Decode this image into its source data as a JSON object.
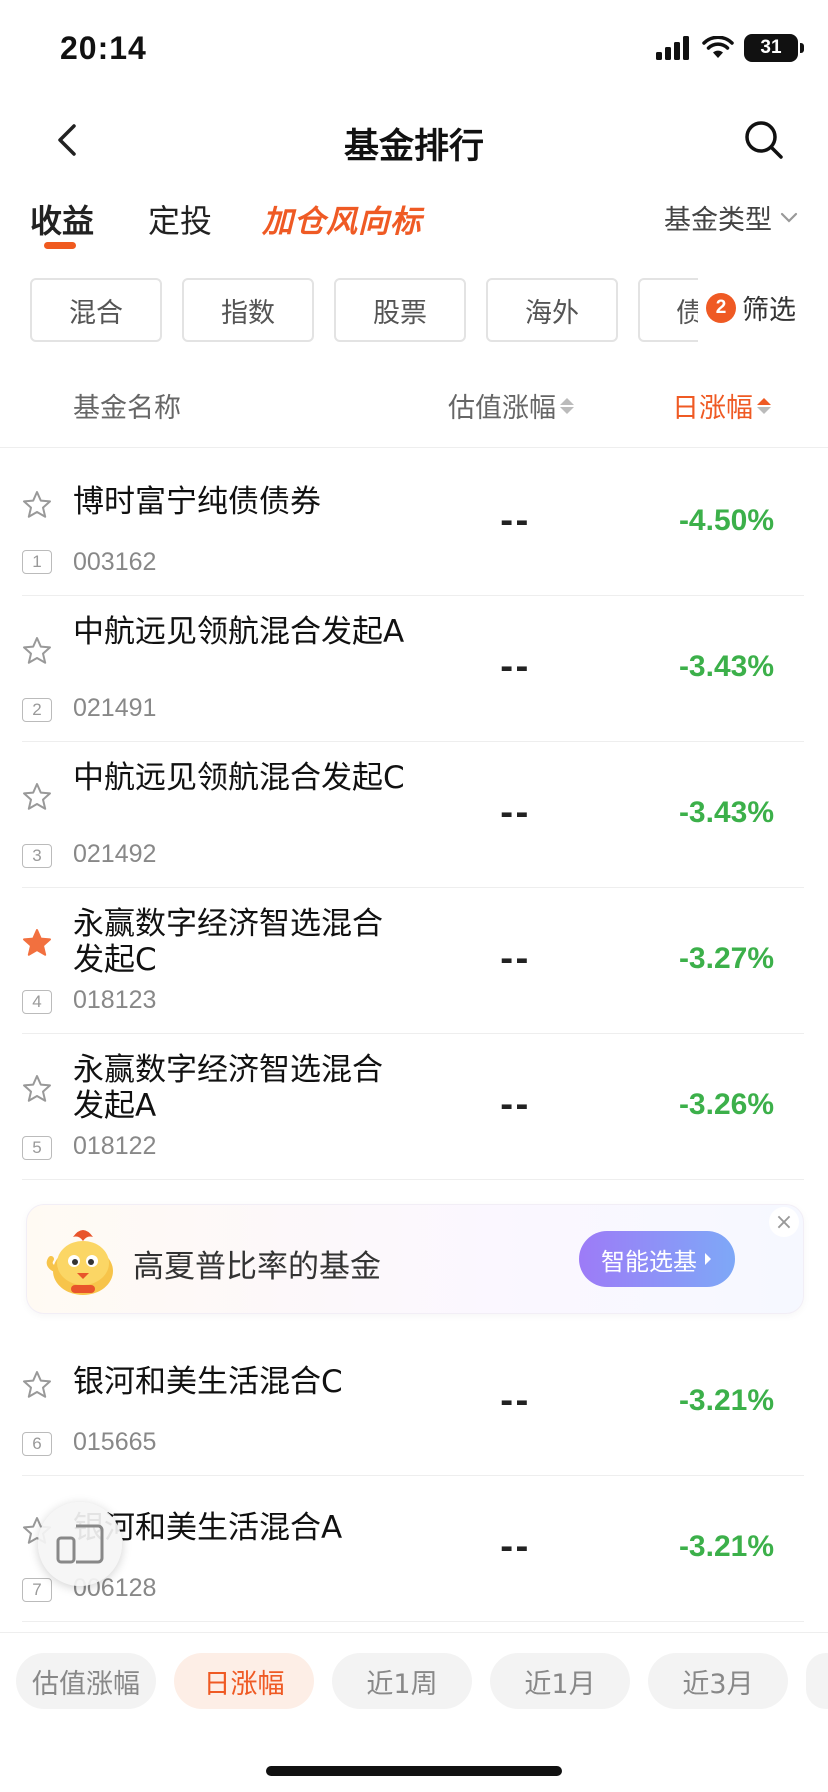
{
  "status_bar": {
    "time": "20:14",
    "battery": "31"
  },
  "nav": {
    "title": "基金排行"
  },
  "tabs": [
    {
      "label": "收益"
    },
    {
      "label": "定投"
    },
    {
      "label": "加仓风向标"
    }
  ],
  "fund_type": {
    "label": "基金类型"
  },
  "chips": [
    {
      "label": "混合"
    },
    {
      "label": "指数"
    },
    {
      "label": "股票"
    },
    {
      "label": "海外"
    },
    {
      "label": "债"
    }
  ],
  "filter": {
    "count": "2",
    "label": "筛选"
  },
  "list_header": {
    "name": "基金名称",
    "estimate": "估值涨幅",
    "daily": "日涨幅"
  },
  "funds": [
    {
      "rank": "1",
      "name": "博时富宁纯债债券",
      "code": "003162",
      "estimate": "--",
      "daily": "-4.50%",
      "starred": false
    },
    {
      "rank": "2",
      "name": "中航远见领航混合发起A",
      "code": "021491",
      "estimate": "--",
      "daily": "-3.43%",
      "starred": false
    },
    {
      "rank": "3",
      "name": "中航远见领航混合发起C",
      "code": "021492",
      "estimate": "--",
      "daily": "-3.43%",
      "starred": false
    },
    {
      "rank": "4",
      "name": "永赢数字经济智选混合发起C",
      "code": "018123",
      "estimate": "--",
      "daily": "-3.27%",
      "starred": true
    },
    {
      "rank": "5",
      "name": "永赢数字经济智选混合发起A",
      "code": "018122",
      "estimate": "--",
      "daily": "-3.26%",
      "starred": false
    },
    {
      "rank": "6",
      "name": "银河和美生活混合C",
      "code": "015665",
      "estimate": "--",
      "daily": "-3.21%",
      "starred": false
    },
    {
      "rank": "7",
      "name": "银河和美生活混合A",
      "code": "006128",
      "estimate": "--",
      "daily": "-3.21%",
      "starred": false
    }
  ],
  "promo": {
    "text": "高夏普比率的基金",
    "button": "智能选基"
  },
  "periods": [
    {
      "label": "估值涨幅"
    },
    {
      "label": "日涨幅"
    },
    {
      "label": "近1周"
    },
    {
      "label": "近1月"
    },
    {
      "label": "近3月"
    }
  ],
  "colors": {
    "accent": "#ef5a24",
    "down": "#3cb04a",
    "star_active": "#f2703f"
  },
  "icons": [
    "back-arrow-icon",
    "search-icon",
    "chevron-down-icon",
    "star-icon",
    "sort-icon",
    "close-icon",
    "mascot-icon",
    "float-window-icon",
    "chevron-right-icon"
  ]
}
